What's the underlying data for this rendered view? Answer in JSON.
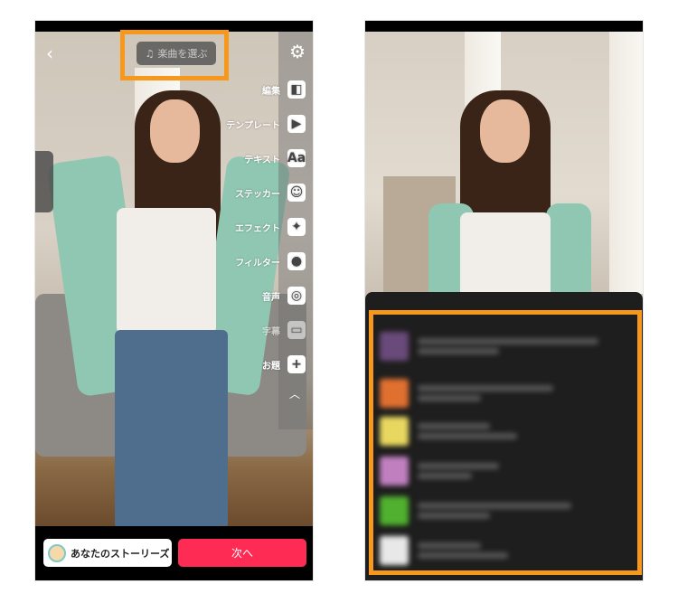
{
  "left_screen": {
    "music_button": {
      "icon": "music-note-icon",
      "label": "楽曲を選ぶ"
    },
    "back_icon": "chevron-left-icon",
    "settings_icon": "gear-icon",
    "tools": [
      {
        "label": "編集",
        "icon": "edit-icon",
        "glyph": "◧"
      },
      {
        "label": "テンプレート",
        "icon": "template-icon",
        "glyph": "▶"
      },
      {
        "label": "テキスト",
        "icon": "text-icon",
        "glyph": "Aa"
      },
      {
        "label": "ステッカー",
        "icon": "sticker-icon",
        "glyph": "☺"
      },
      {
        "label": "エフェクト",
        "icon": "effect-icon",
        "glyph": "✦"
      },
      {
        "label": "フィルター",
        "icon": "filter-icon",
        "glyph": "●"
      },
      {
        "label": "音声",
        "icon": "voice-icon",
        "glyph": "◎"
      },
      {
        "label": "字幕",
        "icon": "caption-icon",
        "glyph": "▭"
      },
      {
        "label": "お題",
        "icon": "topic-icon",
        "glyph": "+"
      }
    ],
    "collapse_icon": "chevron-up-icon",
    "stories_button": "あなたのストーリーズ",
    "next_button": "次へ"
  },
  "colors": {
    "highlight": "#f7981d",
    "primary": "#fe2c55"
  }
}
